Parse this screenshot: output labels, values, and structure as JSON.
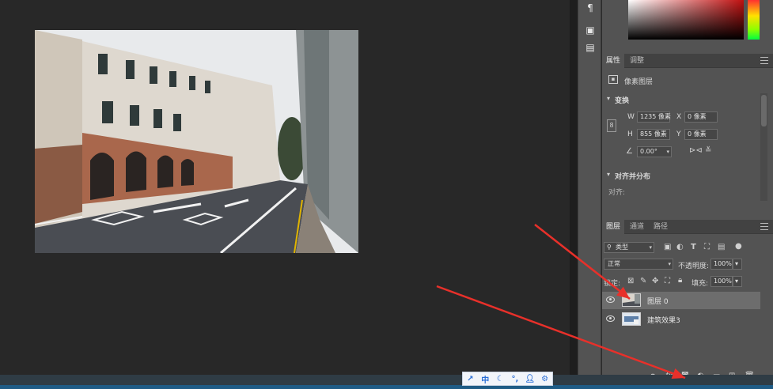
{
  "properties_panel": {
    "tabs": [
      "属性",
      "调整"
    ],
    "layer_type": "像素图层",
    "transform_heading": "变换",
    "w_label": "W",
    "w_value": "1235 像素",
    "x_label": "X",
    "x_value": "0 像素",
    "h_label": "H",
    "h_value": "855 像素",
    "y_label": "Y",
    "y_value": "0 像素",
    "angle_value": "0.00°",
    "align_heading": "对齐并分布",
    "align_label": "对齐:"
  },
  "layers_panel": {
    "tabs": [
      "图层",
      "通道",
      "路径"
    ],
    "filter_kind": "类型",
    "blend_mode": "正常",
    "opacity_label": "不透明度:",
    "opacity_value": "100%",
    "lock_label": "锁定:",
    "fill_label": "填充:",
    "fill_value": "100%",
    "layers": [
      {
        "name": "图层 0",
        "selected": true,
        "visible": true
      },
      {
        "name": "建筑效果3",
        "selected": false,
        "visible": true
      }
    ],
    "footer_fx_label": "fx."
  },
  "ime_toolbar": {
    "mode_label": "中"
  },
  "colors": {
    "annotation_arrow": "#e8302a",
    "app_background": "#282828",
    "panel_background": "#535353",
    "selected_layer": "#6d6d6d"
  }
}
